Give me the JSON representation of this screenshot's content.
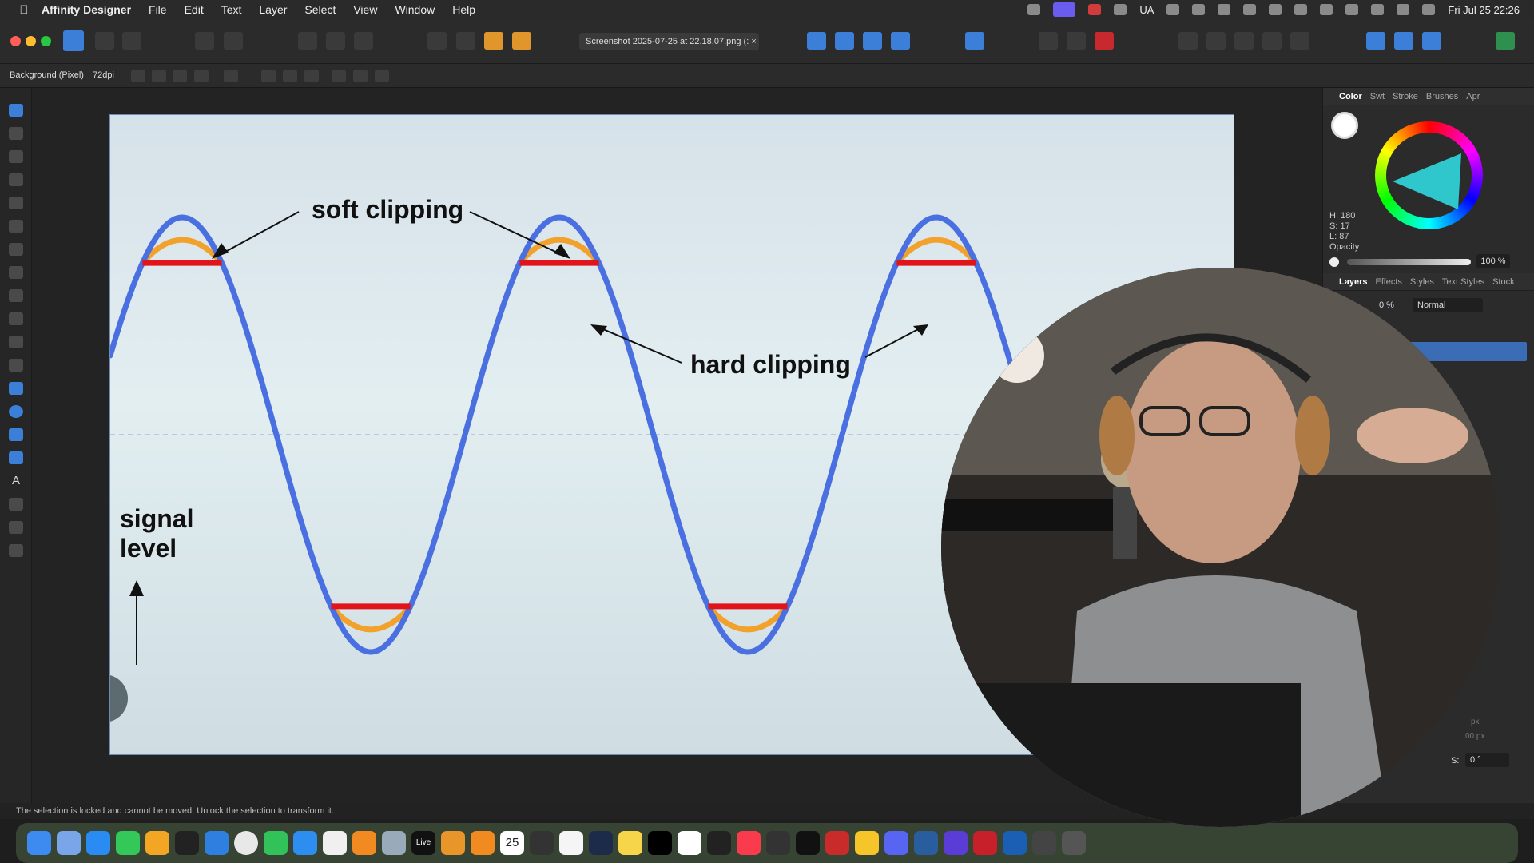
{
  "menubar": {
    "app_name": "Affinity Designer",
    "menus": [
      "File",
      "Edit",
      "Text",
      "Layer",
      "Select",
      "View",
      "Window",
      "Help"
    ],
    "input_source": "UA",
    "clock": "Fri Jul 25  22:26"
  },
  "toolbar": {
    "document_tab": "Screenshot 2025-07-25 at 22.18.07.png (: ×"
  },
  "context_bar": {
    "layer_name": "Background (Pixel)",
    "dpi": "72dpi"
  },
  "canvas": {
    "labels": {
      "soft_clipping": "soft clipping",
      "hard_clipping": "hard clipping",
      "signal_line1": "signal",
      "signal_line2": "level"
    },
    "colors": {
      "wave": "#4a6fe0",
      "soft_clip": "#f2a12b",
      "hard_clip": "#e0141a",
      "text": "#111111"
    },
    "waveform": {
      "cycles_visible": 3,
      "clip_level_fraction": 0.79
    }
  },
  "right_panel": {
    "color_tabs": [
      "Color",
      "Swt",
      "Stroke",
      "Brushes",
      "Apr"
    ],
    "hsl": {
      "h": "H: 180",
      "s": "S: 17",
      "l": "L: 87"
    },
    "opacity_label": "Opacity",
    "opacity_value": "100 %",
    "layer_tabs": [
      "Layers",
      "Effects",
      "Styles",
      "Text Styles",
      "Stock"
    ],
    "blend_mode": "Normal",
    "layer_opacity_partial": "0 %",
    "transform_partial_1": "px",
    "transform_partial_2": "00 px",
    "shear_label": "S:",
    "shear_value": "0 °"
  },
  "statusbar": {
    "message": "The selection is locked and cannot be moved. Unlock the selection to transform it."
  },
  "dock": {
    "calendar_day": "25",
    "live_label": "Live"
  }
}
